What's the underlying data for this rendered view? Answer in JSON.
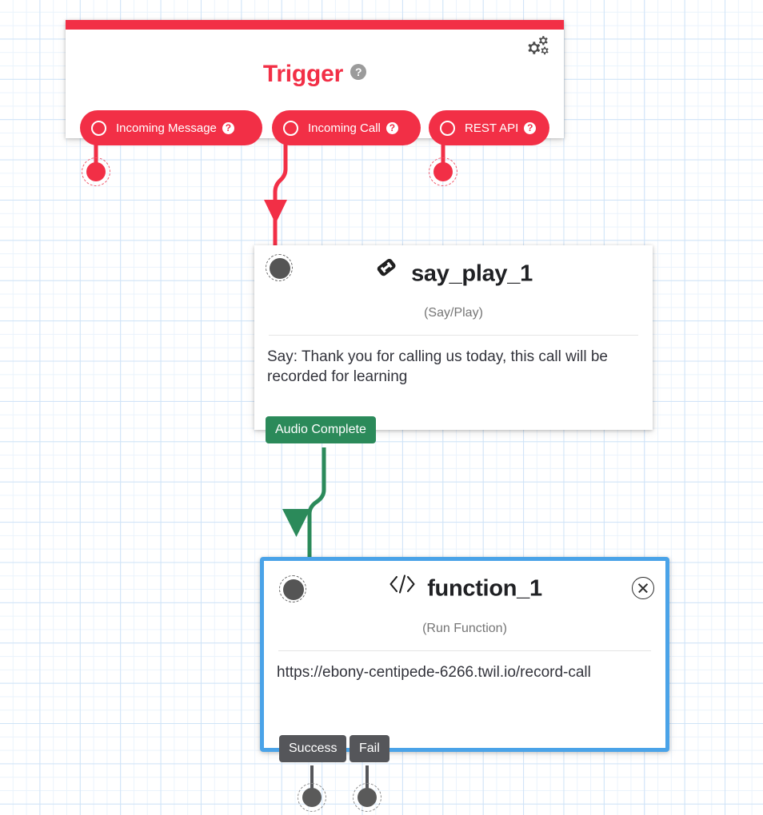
{
  "canvas": {
    "background": "#ffffff",
    "grid_color": "#cfe3f7"
  },
  "trigger": {
    "title": "Trigger",
    "help_icon": "question-mark-icon",
    "help_glyph": "?",
    "settings_icon": "gears-icon",
    "accent_color": "#f22f46",
    "pills": [
      {
        "label": "Incoming Message",
        "radio": "radio-unselected-icon",
        "help_glyph": "?"
      },
      {
        "label": "Incoming Call",
        "radio": "radio-unselected-icon",
        "help_glyph": "?"
      },
      {
        "label": "REST API",
        "radio": "radio-unselected-icon",
        "help_glyph": "?"
      }
    ]
  },
  "say_play_node": {
    "icon": "phone-handset-icon",
    "title": "say_play_1",
    "subtitle": "(Say/Play)",
    "body": "Say: Thank you for calling us today, this call will be recorded for learning",
    "transitions": [
      {
        "label": "Audio Complete",
        "color": "#2b8a5a"
      }
    ]
  },
  "function_node": {
    "icon": "code-brackets-icon",
    "title": "function_1",
    "subtitle": "(Run Function)",
    "body": "https://ebony-centipede-6266.twil.io/record-call",
    "selected": true,
    "selection_color": "#4aa3e8",
    "close_icon": "close-circle-icon",
    "transitions": [
      {
        "label": "Success",
        "color": "#55565a"
      },
      {
        "label": "Fail",
        "color": "#55565a"
      }
    ]
  },
  "connectors": [
    {
      "from": "Incoming Message",
      "color": "#f22f46",
      "endpoint": "unconnected-dot"
    },
    {
      "from": "Incoming Call",
      "color": "#f22f46",
      "endpoint": "say_play_1"
    },
    {
      "from": "REST API",
      "color": "#f22f46",
      "endpoint": "unconnected-dot"
    },
    {
      "from": "Audio Complete",
      "color": "#2b8a5a",
      "endpoint": "function_1"
    },
    {
      "from": "Success",
      "color": "#55565a",
      "endpoint": "unconnected-dot"
    },
    {
      "from": "Fail",
      "color": "#55565a",
      "endpoint": "unconnected-dot"
    }
  ]
}
